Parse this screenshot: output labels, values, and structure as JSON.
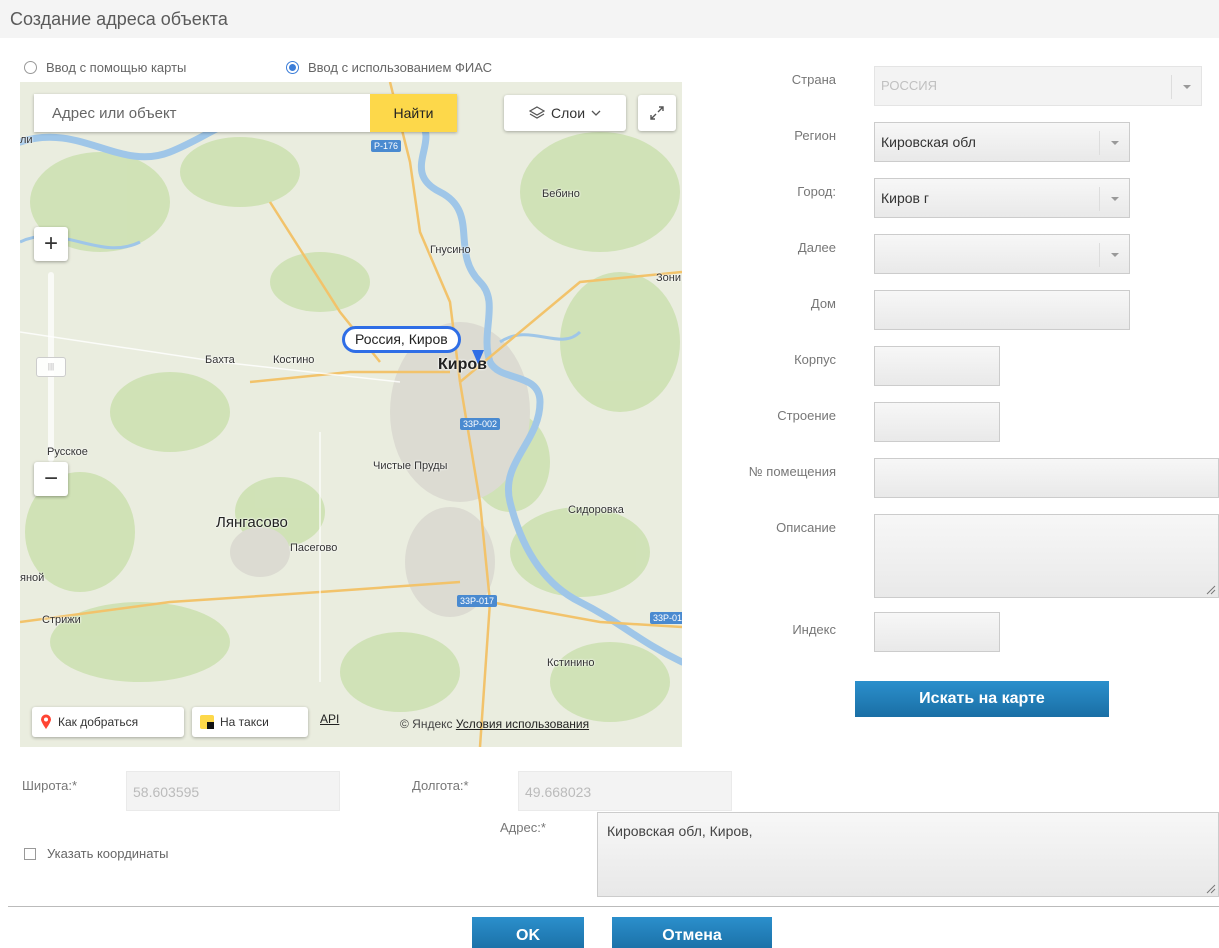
{
  "dialog": {
    "title": "Создание адреса объекта"
  },
  "mode": {
    "options": [
      {
        "label": "Ввод с помощью карты",
        "selected": false
      },
      {
        "label": "Ввод с использованием ФИАС",
        "selected": true
      }
    ]
  },
  "map": {
    "search_placeholder": "Адрес или объект",
    "find_label": "Найти",
    "layers_label": "Слои",
    "balloon_text": "Россия, Киров",
    "places": {
      "kirov": "Киров",
      "bebino": "Бебино",
      "gnusino": "Гнусино",
      "zoni": "Зони",
      "bakhta": "Бахта",
      "kostino": "Костино",
      "russkoe": "Русское",
      "chistye_prudy": "Чистые Пруды",
      "sidorovka": "Сидоровка",
      "lyangasovo": "Лянгасово",
      "pasegovo": "Пасегово",
      "strizhi": "Стрижи",
      "ktinino": "Кстинино",
      "yanoy": "яной",
      "li": "ли"
    },
    "roads": [
      "Р-176",
      "33Р-002",
      "33Р-017",
      "33Р-01"
    ],
    "route_label": "Как добраться",
    "taxi_label": "На такси",
    "api_label": "API",
    "copyright": "© Яндекс",
    "terms": "Условия использования"
  },
  "form": {
    "country": {
      "label": "Страна",
      "value": "РОССИЯ"
    },
    "region": {
      "label": "Регион",
      "value": "Кировская обл"
    },
    "city": {
      "label": "Город:",
      "value": "Киров г"
    },
    "further": {
      "label": "Далее",
      "value": ""
    },
    "house": {
      "label": "Дом",
      "value": ""
    },
    "building": {
      "label": "Корпус",
      "value": ""
    },
    "structure": {
      "label": "Строение",
      "value": ""
    },
    "room": {
      "label": "№ помещения",
      "value": ""
    },
    "description": {
      "label": "Описание",
      "value": ""
    },
    "index": {
      "label": "Индекс",
      "value": ""
    },
    "search_on_map": "Искать на карте"
  },
  "coords": {
    "lat_label": "Широта:*",
    "lat_value": "58.603595",
    "lon_label": "Долгота:*",
    "lon_value": "49.668023",
    "address_label": "Адрес:*",
    "address_value": "Кировская обл, Киров,",
    "specify_label": "Указать координаты"
  },
  "footer": {
    "ok": "OK",
    "cancel": "Отмена"
  },
  "colors": {
    "accent_blue": "#1a6fa5",
    "find_yellow": "#fdd84a",
    "balloon_blue": "#2f6ee6"
  }
}
